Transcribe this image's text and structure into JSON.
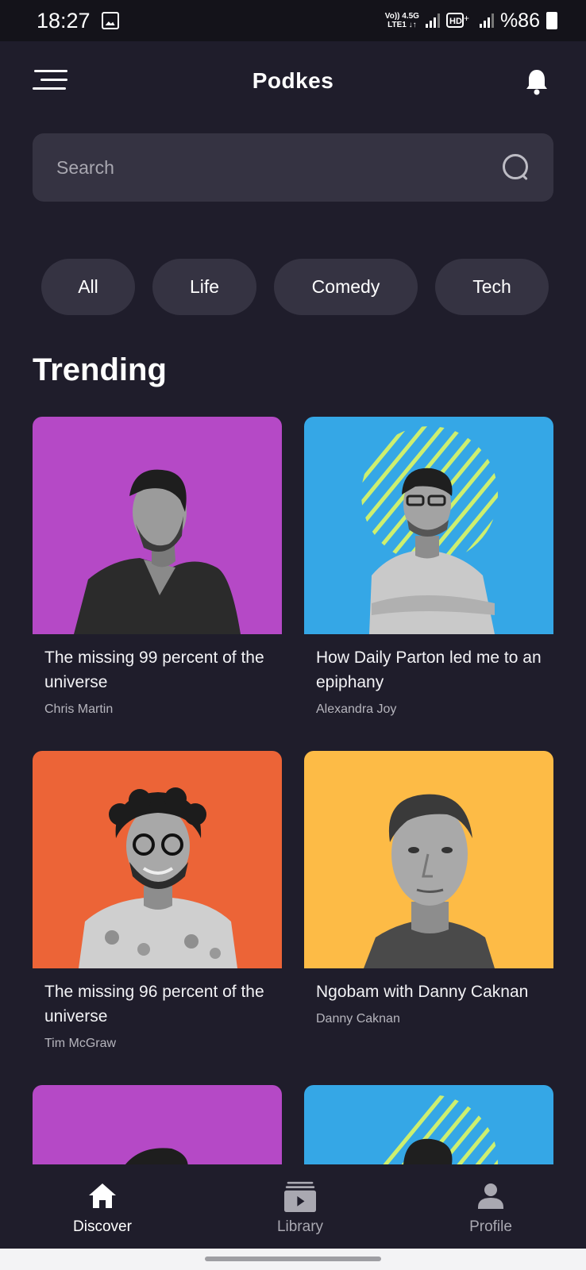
{
  "status_bar": {
    "time": "18:27",
    "network_top": "Vo)) 4.5G",
    "network_bottom": "LTE1 ↓↑",
    "battery": "%86",
    "icons": [
      "image-icon",
      "signal-icon",
      "hd-icon",
      "signal-icon",
      "battery-icon"
    ]
  },
  "header": {
    "title": "Podkes",
    "menu_icon": "menu-icon",
    "notification_icon": "bell-icon"
  },
  "search": {
    "placeholder": "Search",
    "icon": "search-icon"
  },
  "categories": [
    {
      "label": "All"
    },
    {
      "label": "Life"
    },
    {
      "label": "Comedy"
    },
    {
      "label": "Tech"
    }
  ],
  "trending": {
    "title": "Trending",
    "items": [
      {
        "title": "The missing 99 percent of the universe",
        "author": "Chris Martin",
        "bg": "#b549c6"
      },
      {
        "title": "How Daily Parton led me to an epiphany",
        "author": "Alexandra Joy",
        "bg": "#35a7e6"
      },
      {
        "title": "The missing 96 percent of the universe",
        "author": "Tim McGraw",
        "bg": "#ec6437"
      },
      {
        "title": "Ngobam with Danny Caknan",
        "author": "Danny Caknan",
        "bg": "#fdbb46"
      },
      {
        "title": "",
        "author": "",
        "bg": "#b549c6"
      },
      {
        "title": "",
        "author": "",
        "bg": "#35a7e6"
      }
    ]
  },
  "bottom_nav": [
    {
      "label": "Discover",
      "icon": "home-icon",
      "active": true
    },
    {
      "label": "Library",
      "icon": "library-icon",
      "active": false
    },
    {
      "label": "Profile",
      "icon": "profile-icon",
      "active": false
    }
  ],
  "colors": {
    "background": "#1f1d2b",
    "surface": "#353342",
    "text": "#ffffff",
    "muted": "#a8a7b0",
    "inactive_nav": "#a9a8b1",
    "stripe_accent": "#cdef6f"
  }
}
